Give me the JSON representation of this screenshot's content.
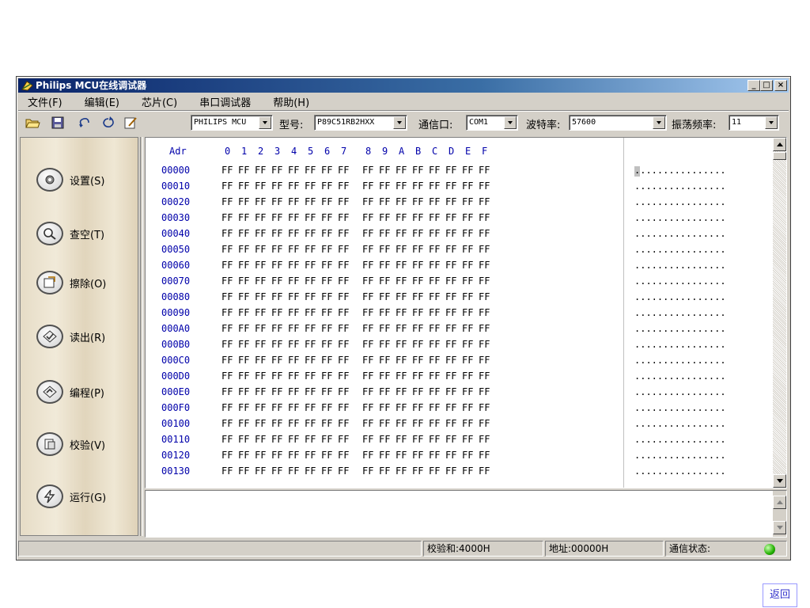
{
  "window": {
    "title": "Philips MCU在线调试器",
    "minimize_glyph": "_",
    "maximize_glyph": "□",
    "close_glyph": "×"
  },
  "menu": [
    "文件(F)",
    "编辑(E)",
    "芯片(C)",
    "串口调试器",
    "帮助(H)"
  ],
  "toolbar": {
    "icons": [
      "open-icon",
      "save-icon",
      "undo-icon",
      "redo-icon",
      "edit-icon"
    ],
    "vendor_value": "PHILIPS MCU",
    "model_label": "型号:",
    "model_value": "P89C51RB2HXX",
    "port_label": "通信口:",
    "port_value": "COM1",
    "baud_label": "波特率:",
    "baud_value": "57600",
    "osc_label": "振荡频率:",
    "osc_value": "11"
  },
  "sidebar": [
    {
      "label": "设置(S)",
      "icon": "settings-icon"
    },
    {
      "label": "查空(T)",
      "icon": "blank-check-icon"
    },
    {
      "label": "擦除(O)",
      "icon": "erase-icon"
    },
    {
      "label": "读出(R)",
      "icon": "read-icon"
    },
    {
      "label": "编程(P)",
      "icon": "program-icon"
    },
    {
      "label": "校验(V)",
      "icon": "verify-icon"
    },
    {
      "label": "运行(G)",
      "icon": "run-icon"
    }
  ],
  "hex": {
    "addr_header": "Adr",
    "columns": [
      "0",
      "1",
      "2",
      "3",
      "4",
      "5",
      "6",
      "7",
      "8",
      "9",
      "A",
      "B",
      "C",
      "D",
      "E",
      "F"
    ],
    "addresses": [
      "00000",
      "00010",
      "00020",
      "00030",
      "00040",
      "00050",
      "00060",
      "00070",
      "00080",
      "00090",
      "000A0",
      "000B0",
      "000C0",
      "000D0",
      "000E0",
      "000F0",
      "00100",
      "00110",
      "00120",
      "00130"
    ],
    "byte_value": "FF",
    "ascii_row": "................"
  },
  "status": {
    "checksum": "校验和:4000H",
    "address": "地址:00000H",
    "comm": "通信状态:"
  },
  "return_button": "返回"
}
